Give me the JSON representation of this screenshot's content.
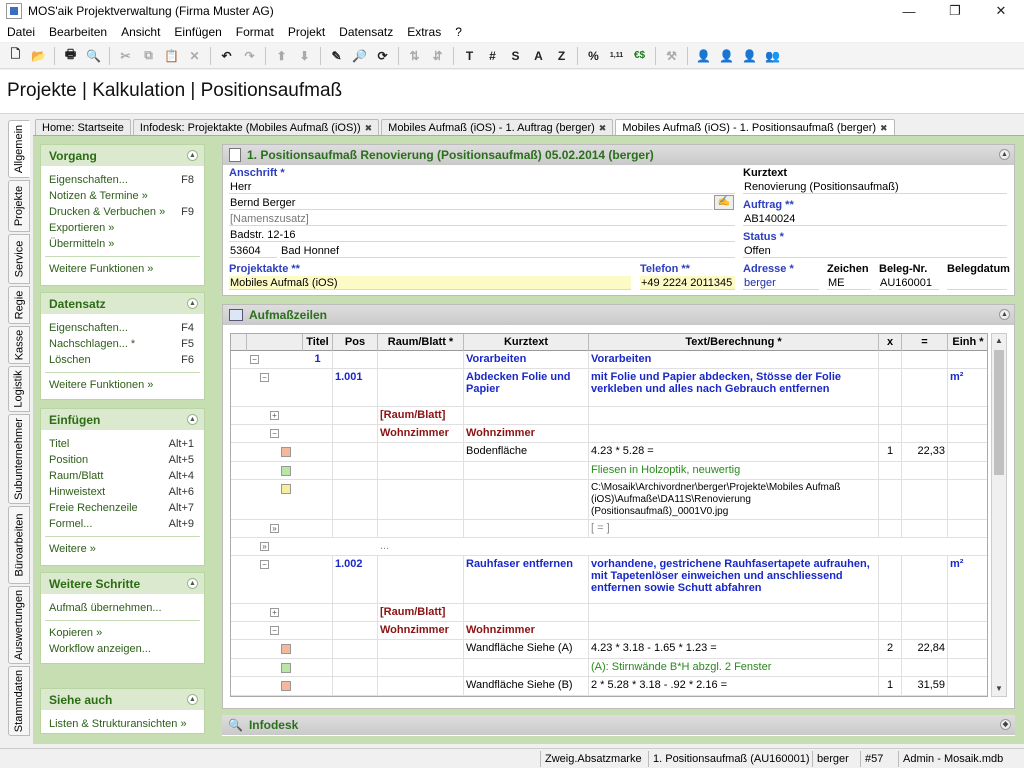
{
  "window": {
    "title": "MOS'aik Projektverwaltung (Firma Muster AG)",
    "min": "—",
    "max": "❐",
    "close": "✕"
  },
  "menu": [
    "Datei",
    "Bearbeiten",
    "Ansicht",
    "Einfügen",
    "Format",
    "Projekt",
    "Datensatz",
    "Extras",
    "?"
  ],
  "toolbar": {
    "text_buttons": [
      "T",
      "#",
      "S",
      "A",
      "Z",
      "%",
      "1,11",
      "€$"
    ]
  },
  "page_title": "Projekte | Kalkulation | Positionsaufmaß",
  "vtabs": [
    "Allgemein",
    "Projekte",
    "Service",
    "Regie",
    "Kasse",
    "Logistik",
    "Subunternehmer",
    "Büroarbeiten",
    "Auswertungen",
    "Stammdaten"
  ],
  "tabs": [
    {
      "label": "Home: Startseite",
      "closable": false
    },
    {
      "label": "Infodesk: Projektakte (Mobiles Aufmaß (iOS))",
      "closable": true
    },
    {
      "label": "Mobiles Aufmaß (iOS) - 1. Auftrag (berger)",
      "closable": true
    },
    {
      "label": "Mobiles Aufmaß (iOS) - 1. Positionsaufmaß (berger)",
      "closable": true
    }
  ],
  "sidebar": {
    "vorgang": {
      "title": "Vorgang",
      "items": [
        {
          "label": "Eigenschaften...",
          "key": "F8"
        },
        {
          "label": "Notizen & Termine »",
          "key": ""
        },
        {
          "label": "Drucken & Verbuchen »",
          "key": "F9"
        },
        {
          "label": "Exportieren »",
          "key": ""
        },
        {
          "label": "Übermitteln »",
          "key": ""
        }
      ],
      "more": "Weitere Funktionen »"
    },
    "datensatz": {
      "title": "Datensatz",
      "items": [
        {
          "label": "Eigenschaften...",
          "key": "F4"
        },
        {
          "label": "Nachschlagen... *",
          "key": "F5"
        },
        {
          "label": "Löschen",
          "key": "F6"
        }
      ],
      "more": "Weitere Funktionen »"
    },
    "einfuegen": {
      "title": "Einfügen",
      "items": [
        {
          "label": "Titel",
          "key": "Alt+1"
        },
        {
          "label": "Position",
          "key": "Alt+5"
        },
        {
          "label": "Raum/Blatt",
          "key": "Alt+4"
        },
        {
          "label": "Hinweistext",
          "key": "Alt+6"
        },
        {
          "label": "Freie Rechenzeile",
          "key": "Alt+7"
        },
        {
          "label": "Formel...",
          "key": "Alt+9"
        }
      ],
      "more": "Weitere »"
    },
    "schritte": {
      "title": "Weitere Schritte",
      "items": [
        "Aufmaß übernehmen...",
        "Kopieren »",
        "Workflow anzeigen..."
      ]
    },
    "siehe": {
      "title": "Siehe auch",
      "items": [
        "Listen & Strukturansichten »"
      ]
    }
  },
  "header_section": {
    "title": "1. Positionsaufmaß Renovierung (Positionsaufmaß) 05.02.2014 (berger)",
    "anschrift_label": "Anschrift *",
    "anschrift": [
      "Herr",
      "Bernd Berger",
      "[Namenszusatz]",
      "Badstr. 12-16"
    ],
    "plz": "53604",
    "ort": "Bad Honnef",
    "projektakte_label": "Projektakte **",
    "projektakte": "Mobiles Aufmaß (iOS)",
    "telefon_label": "Telefon **",
    "telefon": "+49 2224 2011345",
    "kurztext_label": "Kurztext",
    "kurztext": "Renovierung (Positionsaufmaß)",
    "auftrag_label": "Auftrag **",
    "auftrag": "AB140024",
    "status_label": "Status *",
    "status": "Offen",
    "adresse_label": "Adresse *",
    "adresse": "berger",
    "zeichen_label": "Zeichen",
    "zeichen": "ME",
    "belegnr_label": "Beleg-Nr.",
    "belegnr": "AU160001",
    "belegdatum_label": "Belegdatum",
    "belegdatum": ""
  },
  "aufmass": {
    "title": "Aufmaßzeilen",
    "columns": [
      "Titel",
      "Pos",
      "Raum/Blatt *",
      "Kurztext",
      "Text/Berechnung *",
      "x",
      "=",
      "Einh *"
    ],
    "rows": [
      {
        "titel": "1",
        "pos": "",
        "raum": "",
        "kurz": "Vorarbeiten",
        "text": "Vorarbeiten",
        "x": "",
        "eq": "",
        "einh": ""
      },
      {
        "titel": "",
        "pos": "1.001",
        "raum": "",
        "kurz": "Abdecken Folie und Papier",
        "text": "mit Folie und Papier abdecken, Stösse der Folie verkleben und alles nach Gebrauch entfernen",
        "x": "",
        "eq": "",
        "einh": "m²"
      },
      {
        "titel": "",
        "pos": "",
        "raum": "[Raum/Blatt]",
        "kurz": "",
        "text": "",
        "x": "",
        "eq": "",
        "einh": ""
      },
      {
        "titel": "",
        "pos": "",
        "raum": "Wohnzimmer",
        "kurz": "Wohnzimmer",
        "text": "",
        "x": "",
        "eq": "",
        "einh": ""
      },
      {
        "titel": "",
        "pos": "",
        "raum": "",
        "kurz": "Bodenfläche",
        "text": "4.23 * 5.28 =",
        "x": "1",
        "eq": "22,33",
        "einh": ""
      },
      {
        "titel": "",
        "pos": "",
        "raum": "",
        "kurz": "",
        "text": "Fliesen in Holzoptik, neuwertig",
        "x": "",
        "eq": "",
        "einh": ""
      },
      {
        "titel": "",
        "pos": "",
        "raum": "",
        "kurz": "",
        "text": "C:\\Mosaik\\Archivordner\\berger\\Projekte\\Mobiles Aufmaß (iOS)\\Aufmaße\\DA11S\\Renovierung (Positionsaufmaß)_0001V0.jpg",
        "x": "",
        "eq": "",
        "einh": ""
      },
      {
        "titel": "",
        "pos": "",
        "raum": "",
        "kurz": "",
        "text": "[ = ]",
        "x": "",
        "eq": "",
        "einh": ""
      },
      {
        "titel": "",
        "pos": "",
        "raum": "...",
        "kurz": "",
        "text": "",
        "x": "",
        "eq": "",
        "einh": ""
      },
      {
        "titel": "",
        "pos": "1.002",
        "raum": "",
        "kurz": "Rauhfaser entfernen",
        "text": "vorhandene, gestrichene Rauhfasertapete aufrauhen, mit Tapetenlöser einweichen und anschliessend entfernen sowie Schutt abfahren",
        "x": "",
        "eq": "",
        "einh": "m²"
      },
      {
        "titel": "",
        "pos": "",
        "raum": "[Raum/Blatt]",
        "kurz": "",
        "text": "",
        "x": "",
        "eq": "",
        "einh": ""
      },
      {
        "titel": "",
        "pos": "",
        "raum": "Wohnzimmer",
        "kurz": "Wohnzimmer",
        "text": "",
        "x": "",
        "eq": "",
        "einh": ""
      },
      {
        "titel": "",
        "pos": "",
        "raum": "",
        "kurz": "Wandfläche Siehe (A)",
        "text": "4.23 * 3.18 - 1.65 * 1.23 =",
        "x": "2",
        "eq": "22,84",
        "einh": ""
      },
      {
        "titel": "",
        "pos": "",
        "raum": "",
        "kurz": "",
        "text": "(A): Stirnwände B*H abzgl. 2 Fenster",
        "x": "",
        "eq": "",
        "einh": ""
      },
      {
        "titel": "",
        "pos": "",
        "raum": "",
        "kurz": "Wandfläche Siehe (B)",
        "text": "2 * 5.28 * 3.18 - .92 * 2.16 =",
        "x": "1",
        "eq": "31,59",
        "einh": ""
      }
    ]
  },
  "infodesk": {
    "title": "Infodesk"
  },
  "status": [
    "Zweig.Absatzmarke",
    "1. Positionsaufmaß (AU160001)",
    "berger",
    "#57",
    "Admin - Mosaik.mdb"
  ]
}
